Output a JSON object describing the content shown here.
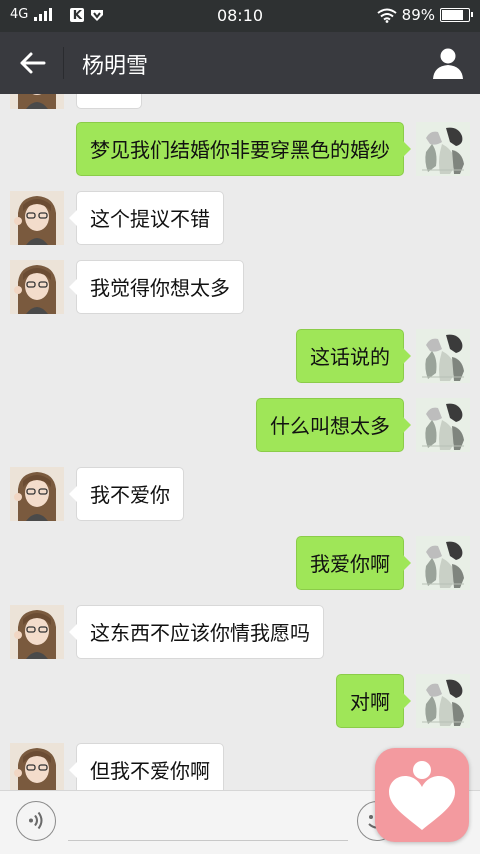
{
  "status_bar": {
    "network": "4G",
    "time": "08:10",
    "battery": "89%",
    "battery_level": 0.89
  },
  "header": {
    "title": "杨明雪"
  },
  "messages": [
    {
      "side": "left",
      "text": ""
    },
    {
      "side": "right",
      "text": "梦见我们结婚你非要穿黑色的婚纱"
    },
    {
      "side": "left",
      "text": "这个提议不错"
    },
    {
      "side": "left",
      "text": "我觉得你想太多"
    },
    {
      "side": "right",
      "text": "这话说的"
    },
    {
      "side": "right",
      "text": "什么叫想太多"
    },
    {
      "side": "left",
      "text": "我不爱你"
    },
    {
      "side": "right",
      "text": "我爱你啊"
    },
    {
      "side": "left",
      "text": "这东西不应该你情我愿吗"
    },
    {
      "side": "right",
      "text": "对啊"
    },
    {
      "side": "left",
      "text": "但我不爱你啊"
    }
  ],
  "input": {
    "value": "",
    "placeholder": ""
  },
  "icons": {
    "back": "arrow-left-icon",
    "profile": "person-icon",
    "voice": "voice-icon",
    "emoji": "emoji-icon",
    "floating": "heart-icon"
  },
  "colors": {
    "title_bar": "#393a3f",
    "status_bar": "#2e3132",
    "chat_bg": "#ebebeb",
    "bubble_sent": "#9fe658",
    "bubble_received": "#ffffff",
    "heart_badge": "#f39a9f"
  }
}
